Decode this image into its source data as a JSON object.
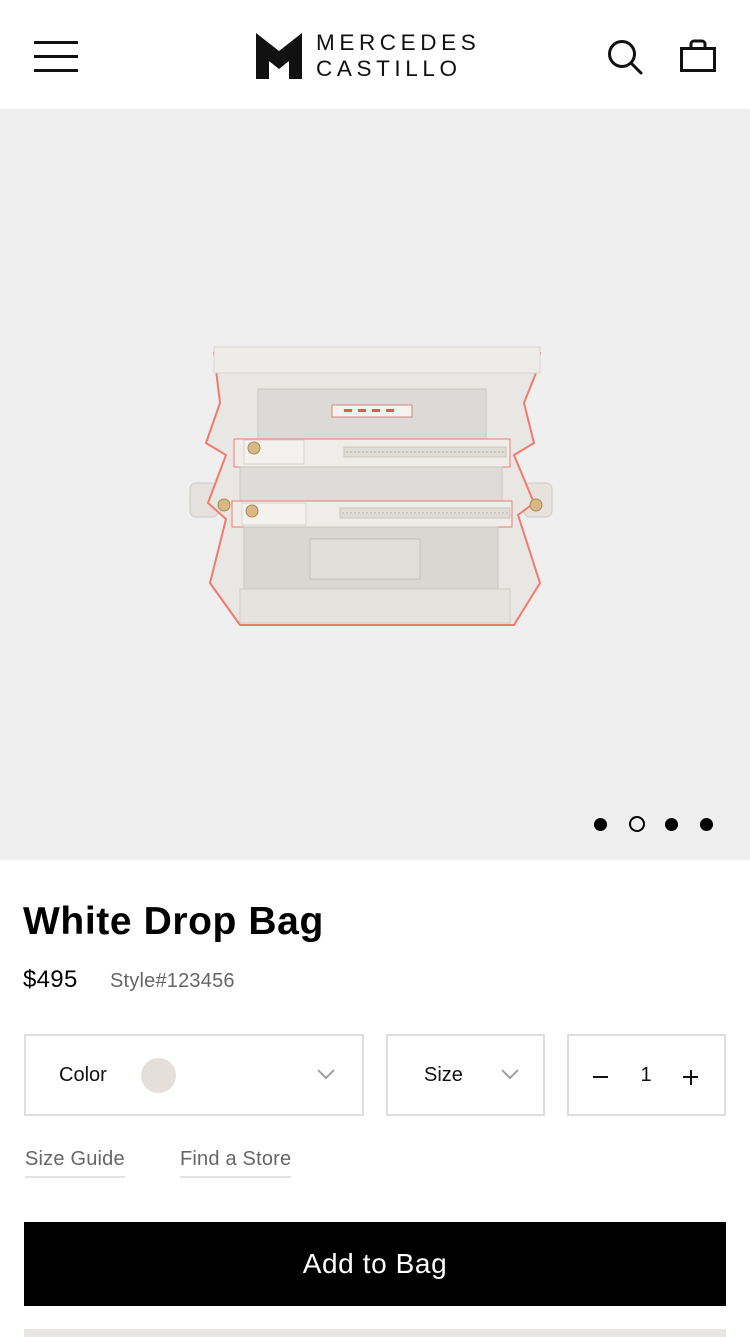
{
  "header": {
    "brand_line1": "MERCEDES",
    "brand_line2": "CASTILLO",
    "menu_icon": "hamburger-menu-icon",
    "search_icon": "search-icon",
    "cart_icon": "shopping-bag-icon"
  },
  "gallery": {
    "image_description": "White Drop Bag product photo",
    "slide_count": 4,
    "active_slide": 2
  },
  "product": {
    "title": "White Drop Bag",
    "price": "$495",
    "style": "Style#123456"
  },
  "options": {
    "color_label": "Color",
    "color_swatch": "#e4dfda",
    "size_label": "Size",
    "quantity": "1"
  },
  "links": {
    "size_guide": "Size Guide",
    "find_store": "Find a Store"
  },
  "actions": {
    "add_to_bag": "Add to Bag"
  },
  "colors": {
    "accent": "#000000",
    "gallery_bg": "#efefef",
    "bag_trim": "#f27a6c"
  }
}
